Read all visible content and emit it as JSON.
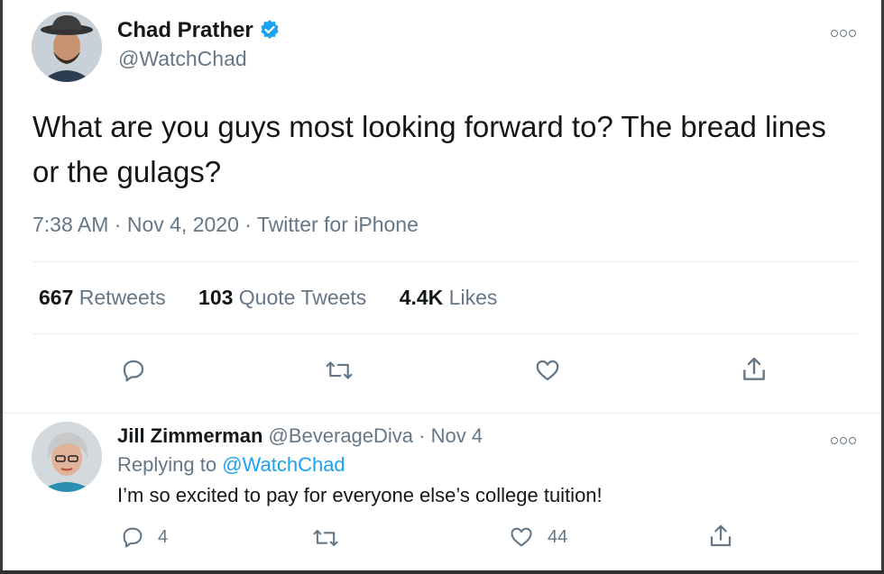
{
  "main_tweet": {
    "author_name": "Chad Prather",
    "author_handle": "@WatchChad",
    "verified": true,
    "text": "What are you guys most looking forward to? The bread lines or the gulags?",
    "time": "7:38 AM",
    "date": "Nov 4, 2020",
    "source": "Twitter for iPhone",
    "separator": "·",
    "stats": {
      "retweets_count": "667",
      "retweets_label": "Retweets",
      "quotes_count": "103",
      "quotes_label": "Quote Tweets",
      "likes_count": "4.4K",
      "likes_label": "Likes"
    }
  },
  "reply_tweet": {
    "author_name": "Jill Zimmerman",
    "author_handle": "@BeverageDiva",
    "separator": "·",
    "date": "Nov 4",
    "replying_to_label": "Replying to",
    "replying_to_handle": "@WatchChad",
    "text": "I’m so excited to pay for everyone else’s college tuition!",
    "reply_count": "4",
    "like_count": "44"
  },
  "colors": {
    "accent": "#1da1f2",
    "muted": "#657786",
    "text": "#14171a"
  },
  "icons": [
    "more-icon",
    "verified-badge-icon",
    "reply-icon",
    "retweet-icon",
    "like-icon",
    "share-icon"
  ]
}
